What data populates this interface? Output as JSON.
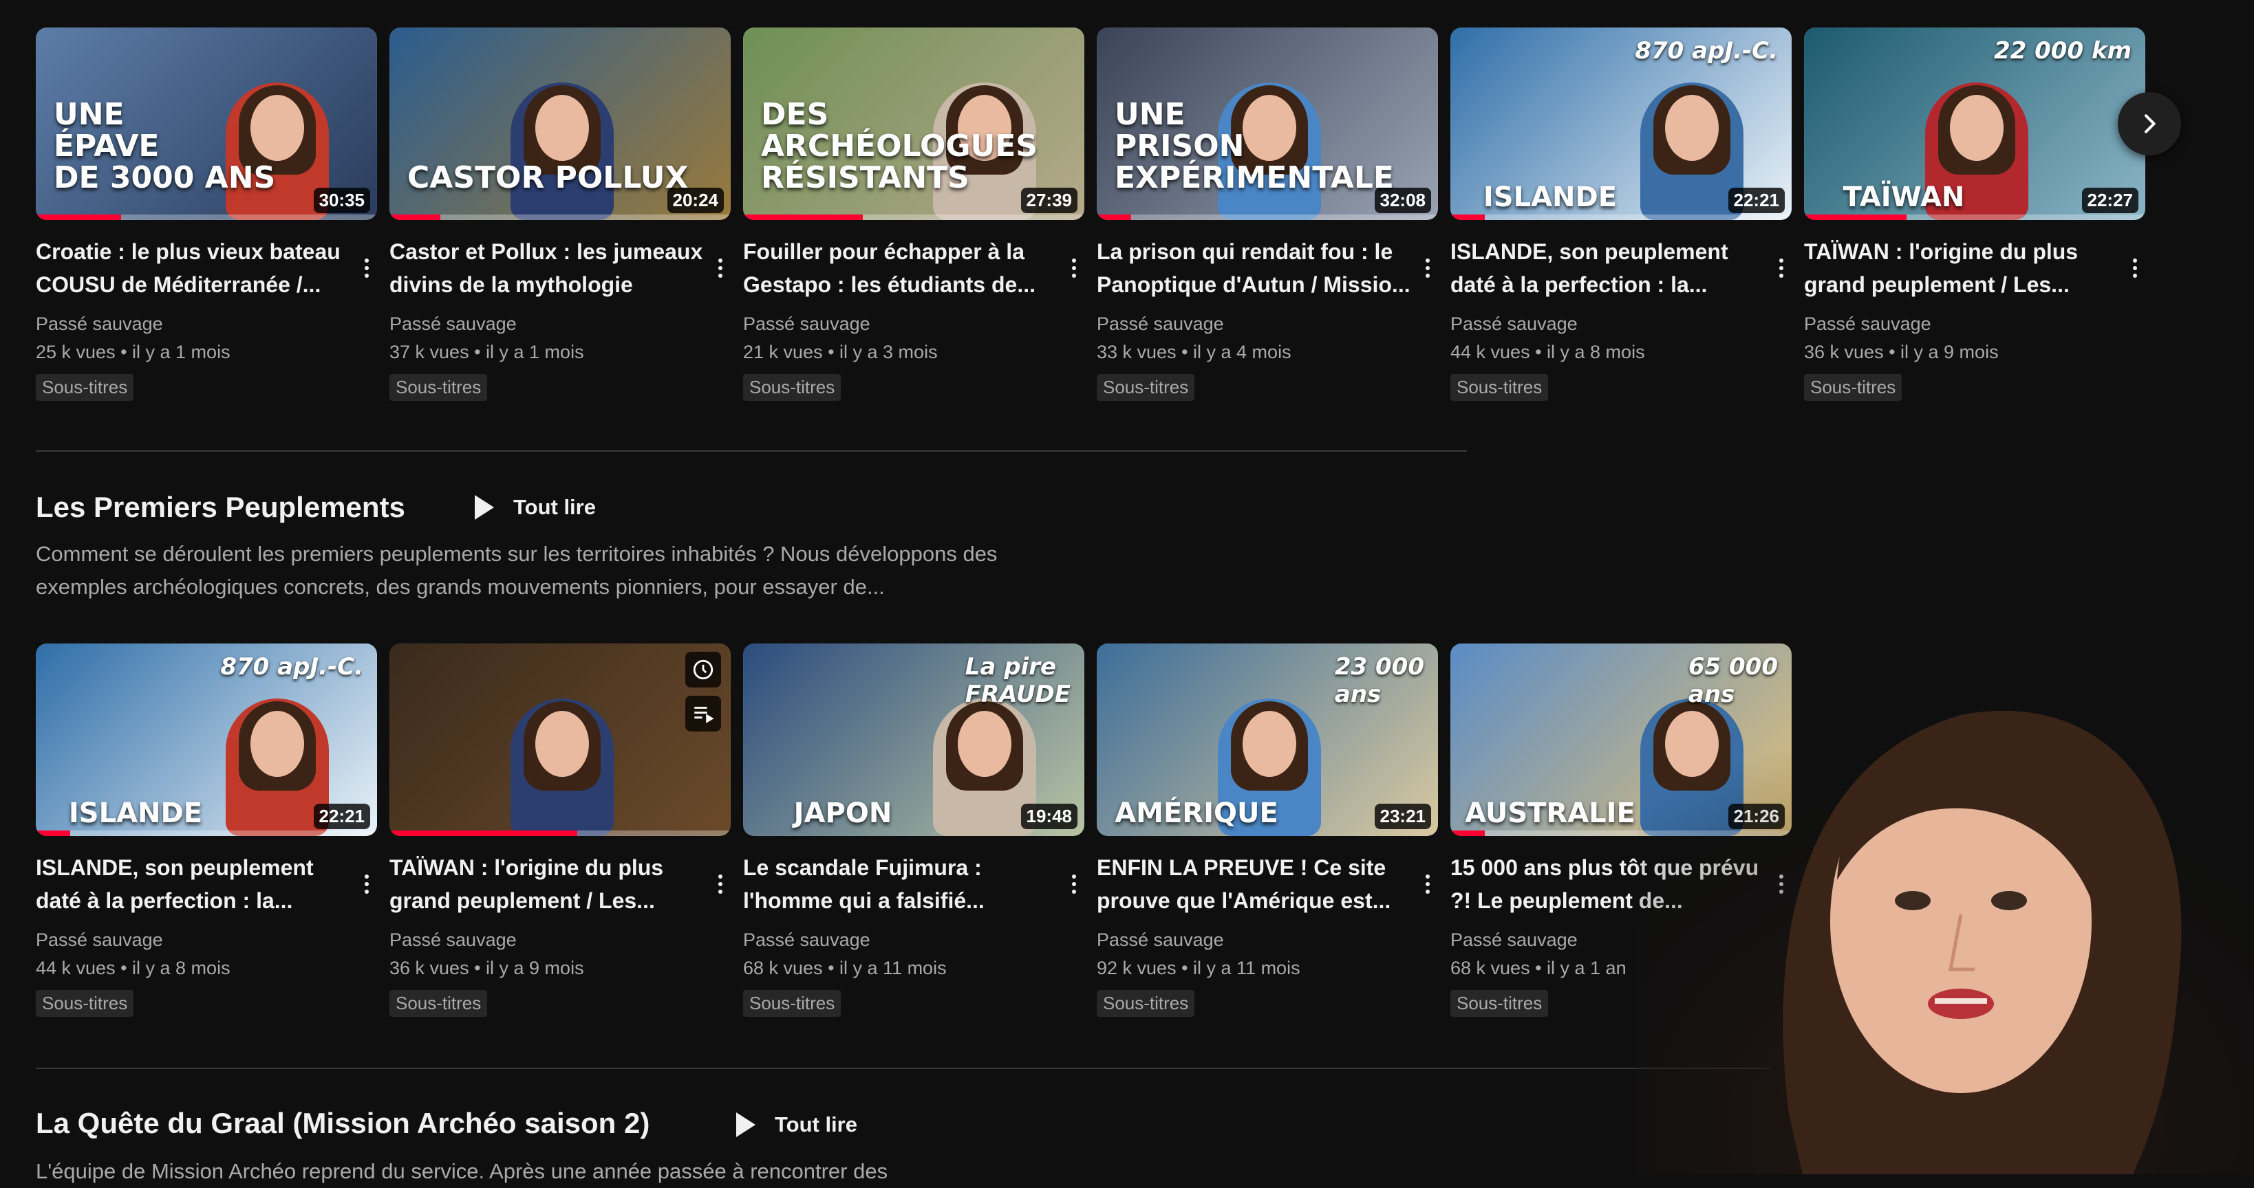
{
  "shelves": [
    {
      "videos": [
        {
          "thumb_text": "UNE\nÉPAVE\nDE 3000 ANS",
          "duration": "30:35",
          "watched": 0.25,
          "title": "Croatie : le plus vieux bateau COUSU de Méditerranée /...",
          "channel": "Passé sauvage",
          "stats": "25 k vues • il y a 1 mois",
          "badge": "Sous-titres"
        },
        {
          "thumb_text": "CASTOR   POLLUX",
          "duration": "20:24",
          "watched": 0.15,
          "title": "Castor et Pollux : les jumeaux divins de la mythologie",
          "channel": "Passé sauvage",
          "stats": "37 k vues • il y a 1 mois",
          "badge": "Sous-titres"
        },
        {
          "thumb_text": "DES\nARCHÉOLOGUES\nRÉSISTANTS",
          "duration": "27:39",
          "watched": 0.35,
          "title": "Fouiller pour échapper à la Gestapo : les étudiants de...",
          "channel": "Passé sauvage",
          "stats": "21 k vues • il y a 3 mois",
          "badge": "Sous-titres"
        },
        {
          "thumb_text": "UNE\nPRISON\nEXPÉRIMENTALE",
          "duration": "32:08",
          "watched": 0.1,
          "title": "La prison qui rendait fou : le Panoptique d'Autun / Missio...",
          "channel": "Passé sauvage",
          "stats": "33 k vues • il y a 4 mois",
          "badge": "Sous-titres"
        },
        {
          "thumb_text": "ISLANDE",
          "thumb_annot": "870 apJ.-C.",
          "duration": "22:21",
          "watched": 0.1,
          "title": "ISLANDE, son peuplement daté à la perfection : la...",
          "channel": "Passé sauvage",
          "stats": "44 k vues • il y a 8 mois",
          "badge": "Sous-titres"
        },
        {
          "thumb_text": "TAÏWAN",
          "thumb_annot": "22 000 km",
          "duration": "22:27",
          "watched": 0.3,
          "title": "TAÏWAN : l'origine du plus grand peuplement / Les...",
          "channel": "Passé sauvage",
          "stats": "36 k vues • il y a 9 mois",
          "badge": "Sous-titres"
        }
      ]
    },
    {
      "heading": "Les Premiers Peuplements",
      "play_all": "Tout lire",
      "description": "Comment se déroulent les premiers peuplements sur les territoires inhabités ? Nous développons des exemples archéologiques concrets, des grands mouvements pionniers, pour essayer de...",
      "videos": [
        {
          "thumb_text": "ISLANDE",
          "thumb_annot": "870 apJ.-C.",
          "duration": "22:21",
          "watched": 0.1,
          "title": "ISLANDE, son peuplement daté à la perfection : la...",
          "channel": "Passé sauvage",
          "stats": "44 k vues • il y a 8 mois",
          "badge": "Sous-titres"
        },
        {
          "thumb_text": "",
          "duration": "",
          "watched": 0.55,
          "title": "TAÏWAN : l'origine du plus grand peuplement / Les...",
          "channel": "Passé sauvage",
          "stats": "36 k vues • il y a 9 mois",
          "badge": "Sous-titres"
        },
        {
          "thumb_text": "JAPON",
          "thumb_annot": "La pire\nFRAUDE",
          "duration": "19:48",
          "watched": 0.0,
          "title": "Le scandale Fujimura : l'homme qui a falsifié...",
          "channel": "Passé sauvage",
          "stats": "68 k vues • il y a 11 mois",
          "badge": "Sous-titres"
        },
        {
          "thumb_text": "AMÉRIQUE",
          "thumb_annot": "23 000\nans",
          "duration": "23:21",
          "watched": 0.0,
          "title": "ENFIN LA PREUVE ! Ce site prouve que l'Amérique est...",
          "channel": "Passé sauvage",
          "stats": "92 k vues • il y a 11 mois",
          "badge": "Sous-titres"
        },
        {
          "thumb_text": "AUSTRALIE",
          "thumb_annot": "65 000\nans",
          "duration": "21:26",
          "watched": 0.1,
          "title": "15 000 ans plus tôt que prévu ?! Le peuplement de...",
          "channel": "Passé sauvage",
          "stats": "68 k vues • il y a 1 an",
          "badge": "Sous-titres"
        }
      ]
    },
    {
      "heading": "La Quête du Graal (Mission Archéo saison 2)",
      "play_all": "Tout lire",
      "description": "L'équipe de Mission Archéo reprend du service. Après une année passée à rencontrer des"
    }
  ]
}
